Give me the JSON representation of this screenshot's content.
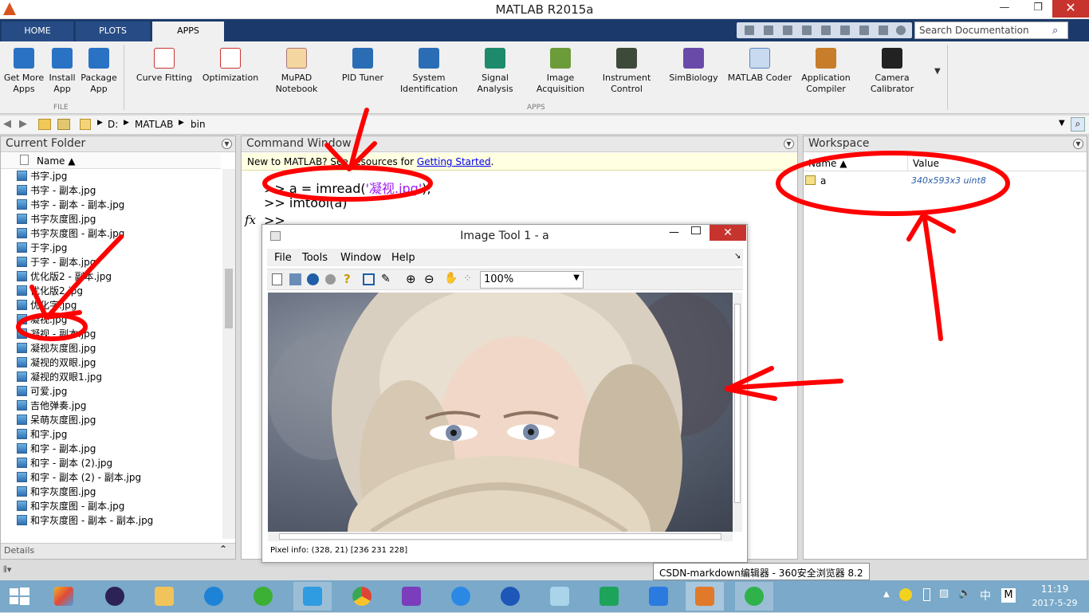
{
  "window": {
    "title": "MATLAB R2015a",
    "minimize": "—",
    "restore": "❐",
    "close": "✕"
  },
  "tabs": [
    "HOME",
    "PLOTS",
    "APPS"
  ],
  "search": {
    "placeholder": "Search Documentation"
  },
  "ribbon": {
    "file_group": {
      "label": "FILE",
      "items": [
        "Get More\nApps",
        "Install\nApp",
        "Package\nApp"
      ]
    },
    "apps_group": {
      "label": "APPS",
      "items": [
        "Curve Fitting",
        "Optimization",
        "MuPAD\nNotebook",
        "PID Tuner",
        "System\nIdentification",
        "Signal Analysis",
        "Image\nAcquisition",
        "Instrument\nControl",
        "SimBiology",
        "MATLAB Coder",
        "Application\nCompiler",
        "Camera\nCalibrator"
      ]
    }
  },
  "address": {
    "path": [
      "D:",
      "MATLAB",
      "bin"
    ]
  },
  "current_folder": {
    "title": "Current Folder",
    "name_header": "Name ▲",
    "files": [
      "书字.jpg",
      "书字 - 副本.jpg",
      "书字 - 副本 - 副本.jpg",
      "书字灰度图.jpg",
      "书字灰度图 - 副本.jpg",
      "于字.jpg",
      "于字 - 副本.jpg",
      "优化版2 - 副本.jpg",
      "优化版2.jpg",
      "优化字.jpg",
      "凝视.jpg",
      "凝视 - 副本.jpg",
      "凝视灰度图.jpg",
      "凝视的双眼.jpg",
      "凝视的双眼1.jpg",
      "可爱.jpg",
      "吉他弹奏.jpg",
      "呆萌灰度图.jpg",
      "和字.jpg",
      "和字 - 副本.jpg",
      "和字 - 副本 (2).jpg",
      "和字 - 副本 (2) - 副本.jpg",
      "和字灰度图.jpg",
      "和字灰度图 - 副本.jpg",
      "和字灰度图 - 副本 - 副本.jpg"
    ],
    "details_label": "Details"
  },
  "command_window": {
    "title": "Command Window",
    "banner_prefix": "New to MATLAB? See resources for ",
    "banner_link": "Getting Started",
    "banner_suffix": ".",
    "line1_prefix": ">> a = imread(",
    "line1_string": "'凝视.jpg'",
    "line1_suffix": ");",
    "line2": ">> imtool(a)",
    "line3": ">>",
    "fx": "fx"
  },
  "workspace": {
    "title": "Workspace",
    "col_name": "Name ▲",
    "col_value": "Value",
    "var_name": "a",
    "var_value": "340x593x3 uint8"
  },
  "image_tool": {
    "title": "Image Tool 1 - a",
    "menu": [
      "File",
      "Tools",
      "Window",
      "Help"
    ],
    "zoom": "100%",
    "status": "Pixel info: (328, 21)  [236 231 228]"
  },
  "tooltip": "CSDN-markdown编辑器 - 360安全浏览器 8.2",
  "taskbar": {
    "time": "11:19",
    "date": "2017-5-29",
    "ime": "中",
    "tray_m": "M"
  },
  "colors": {
    "accent_tab": "#1b3a6b",
    "annotation": "#ff0000",
    "link": "#0000ee",
    "string": "#a020f0"
  }
}
